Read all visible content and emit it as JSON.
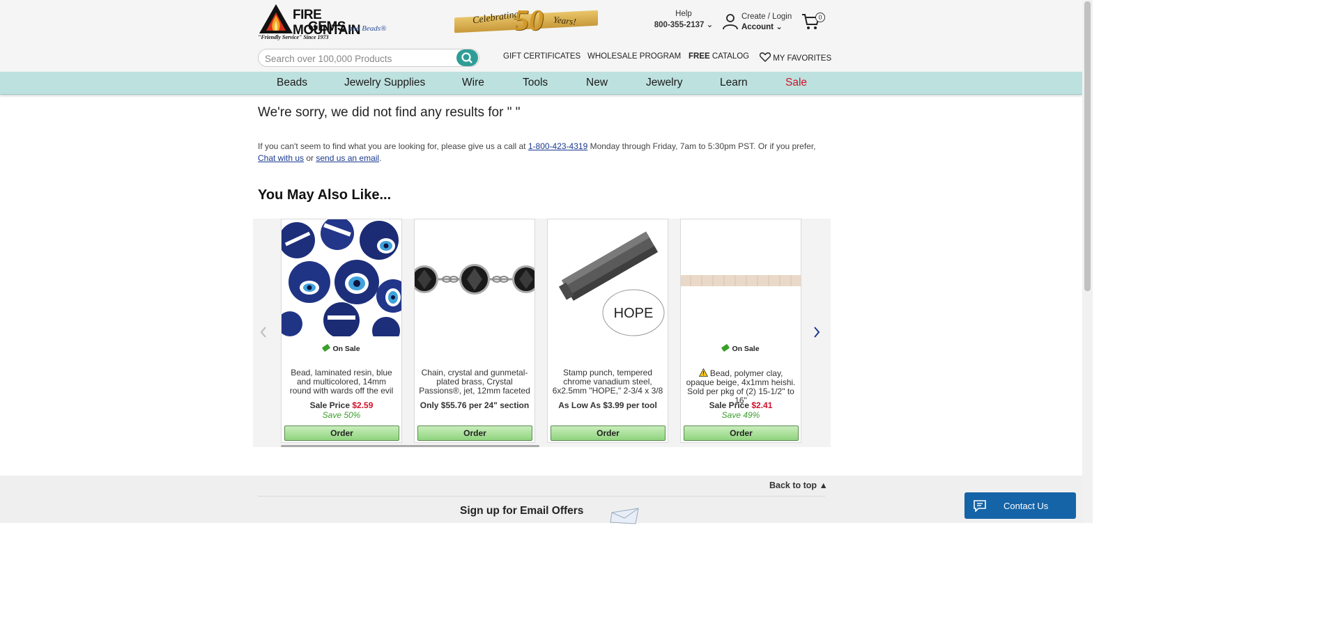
{
  "header": {
    "logo": {
      "line1": "FIRE MOUNTAIN",
      "line2": "GEMS",
      "line3": "and Beads®",
      "tagline": "\"Friendly Service\" Since 1973"
    },
    "anniversary": {
      "left": "Celebrating",
      "number": "50",
      "right": "Years!"
    },
    "help": {
      "label": "Help",
      "phone": "800-355-2137"
    },
    "account": {
      "line1": "Create / Login",
      "line2": "Account"
    },
    "cart": {
      "count": "0"
    },
    "search": {
      "placeholder": "Search over 100,000 Products"
    },
    "links": {
      "gift": "GIFT CERTIFICATES",
      "wholesale": "WHOLESALE PROGRAM",
      "catalog_bold": "FREE",
      "catalog_rest": " CATALOG",
      "favorites": "MY FAVORITES"
    }
  },
  "nav": {
    "items": [
      "Beads",
      "Jewelry Supplies",
      "Wire",
      "Tools",
      "New",
      "Jewelry",
      "Learn",
      "Sale"
    ]
  },
  "main": {
    "sorry": "We're sorry, we did not find any results for  \" \"",
    "help_pre": "If you can't seem to find what you are looking for, please give us a call at ",
    "help_phone": "1-800-423-4319",
    "help_mid": " Monday through Friday, 7am to 5:30pm PST. Or if you prefer, ",
    "help_chat": "Chat with us",
    "help_or": " or ",
    "help_email": "send us an email",
    "help_end": ".",
    "ymal": "You May Also Like..."
  },
  "products": [
    {
      "on_sale": "On Sale",
      "title": "Bead, laminated resin, blue and multicolored, 14mm round with wards off the evil",
      "price_label": "Sale Price ",
      "price": "$2.59",
      "save": "Save 50%",
      "order": "Order"
    },
    {
      "on_sale": "",
      "title": "Chain, crystal and gunmetal-plated brass, Crystal Passions®, jet, 12mm faceted",
      "price_label": "Only $55.76 per 24\" section",
      "price": "",
      "save": "",
      "order": "Order"
    },
    {
      "on_sale": "",
      "title": "Stamp punch, tempered chrome vanadium steel, 6x2.5mm \"HOPE,\" 2-3/4 x 3/8",
      "price_label": "As Low As $3.99 per tool",
      "price": "",
      "save": "",
      "order": "Order"
    },
    {
      "on_sale": "On Sale",
      "title": "Bead, polymer clay, opaque beige, 4x1mm heishi. Sold per pkg of (2) 15-1/2\" to 16\"",
      "price_label": "Sale Price ",
      "price": "$2.41",
      "save": "Save 49%",
      "order": "Order"
    }
  ],
  "stamp_word": "HOPE",
  "footer": {
    "back_to_top": "Back to top",
    "signup": "Sign up for Email Offers"
  },
  "contact": {
    "label": "Contact Us"
  },
  "colors": {
    "nav_bg": "#bde1de",
    "sale_red": "#d0112b",
    "teal": "#2f9d96",
    "contact_blue": "#1564a8",
    "order_green": "#8fd47e"
  }
}
